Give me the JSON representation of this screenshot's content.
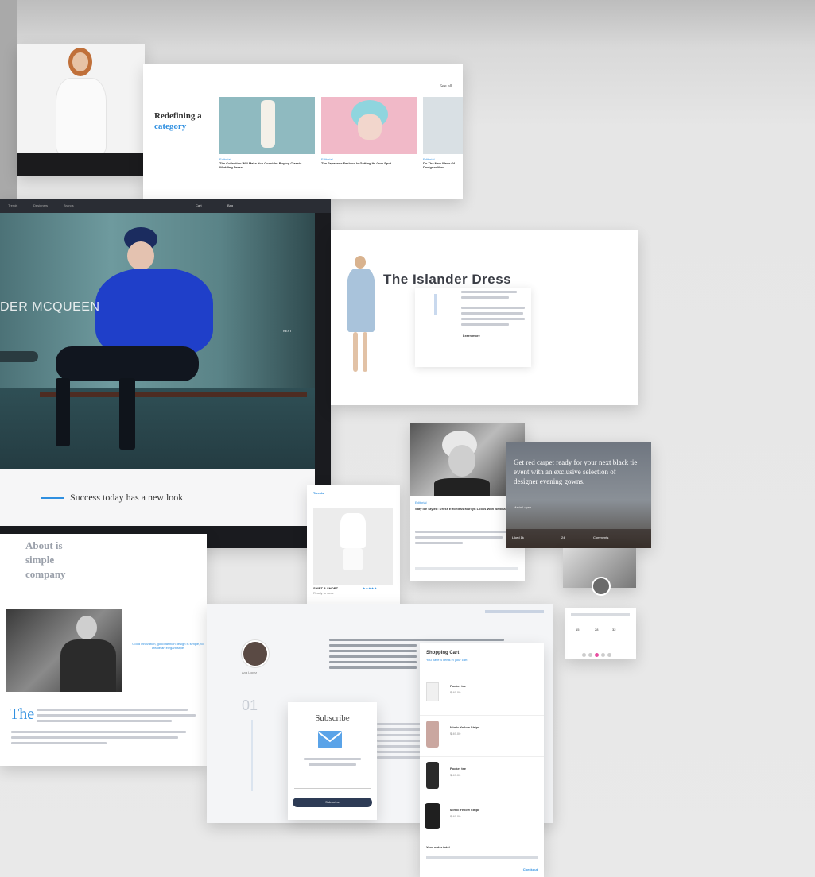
{
  "category_card": {
    "title_line1": "Redefining a",
    "title_line2": "category",
    "top_link": "See all",
    "items": [
      {
        "tag": "Editorial",
        "title": "The Collection Will Make You Consider Buying Classic Wedding Dress"
      },
      {
        "tag": "Editorial",
        "title": "The Japanese Fashion Is Getting Its Own Spot"
      },
      {
        "tag": "Editorial",
        "title": "Do The New Wave Of Designer Now"
      }
    ]
  },
  "hero": {
    "nav": [
      "Trends",
      "Designers",
      "Brands"
    ],
    "nav_right": [
      "Cart",
      "Bag"
    ],
    "headline": "DER MCQUEEN",
    "pager": "NEXT",
    "tagline": "Success today has a new look"
  },
  "islander": {
    "title": "The Islander Dress",
    "cta": "Learn more"
  },
  "trends_card": {
    "header": "Trends",
    "product_name": "SHIRT & SHORT",
    "product_sub": "Ready to wear",
    "rating": "★★★★★"
  },
  "article_card": {
    "tag": "Editorial",
    "title": "Stay Ice Styled: Dress Effortless Marilyn Looks With Bettinas"
  },
  "quote_card": {
    "quote": "Get red carpet ready for your next black tie event with an exclusive selection of designer evening gowns.",
    "author": "Maria Lopez",
    "stats": [
      "Liked 1k",
      "24",
      "Comments"
    ]
  },
  "about_card": {
    "title": "About is simple company",
    "drop_cap": "The",
    "pull_quote": "Good innovation, good fashion design is simple, to create an elegant style"
  },
  "author_col": {
    "name": "Ana Lopez",
    "number": "01"
  },
  "subscribe": {
    "title": "Subscribe",
    "button": "Subscribe"
  },
  "cart": {
    "title": "Shopping Cart",
    "subtitle": "You have 4 items in your cart",
    "items": [
      {
        "name": "Pocket tee",
        "price": "$ 49.00"
      },
      {
        "name": "Mimic Yellow Stripe",
        "price": "$ 49.00"
      },
      {
        "name": "Pocket tee",
        "price": "$ 49.00"
      },
      {
        "name": "Mimic Yellow Stripe",
        "price": "$ 49.00"
      }
    ],
    "footer_left": "Your order total",
    "footer_right": "Checkout"
  },
  "counter_card": {
    "values": [
      "15",
      "28",
      "32"
    ]
  },
  "colors": {
    "accent": "#2f8fe0",
    "dark_nav": "#2a2d34",
    "hero_blue": "#1f3fc9",
    "hero_bg": "#5f8a8f"
  }
}
